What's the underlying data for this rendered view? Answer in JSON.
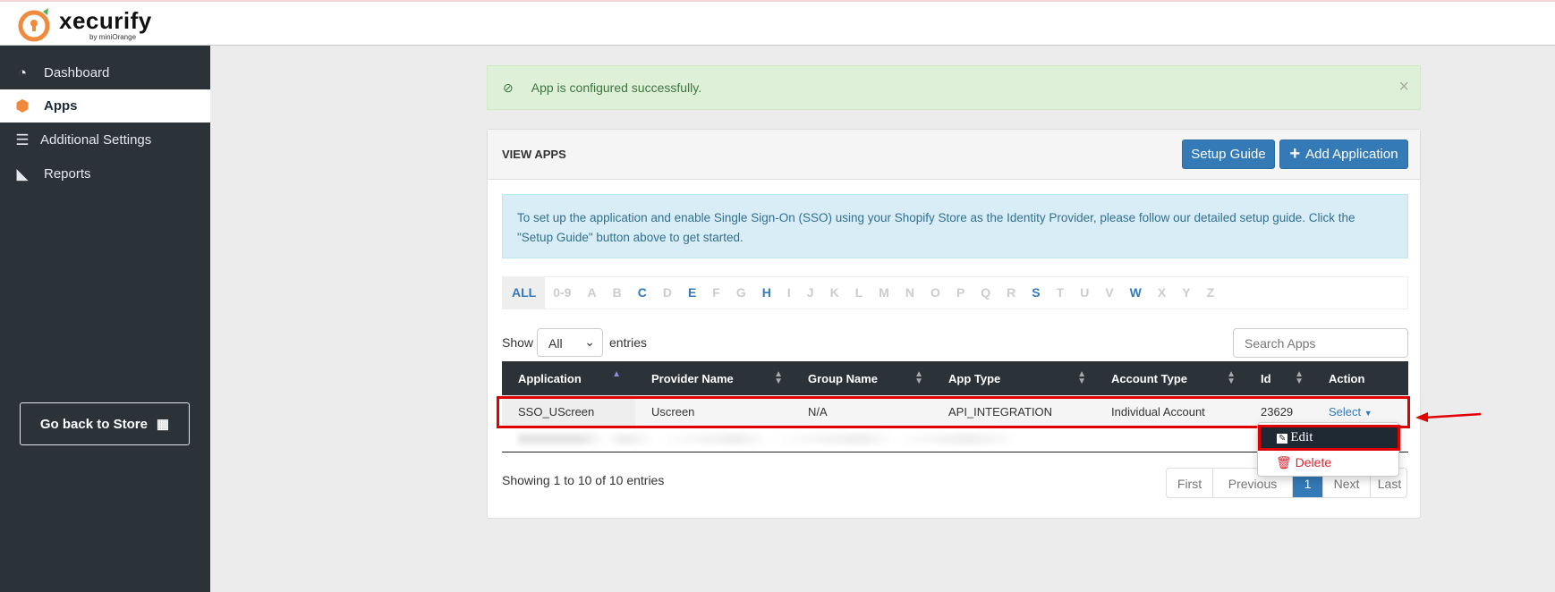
{
  "brand": {
    "name": "xecurify",
    "byline": "by miniOrange",
    "accent": "#f08a3c"
  },
  "sidebar": {
    "items": [
      {
        "label": "Dashboard",
        "icon": "dashboard-icon"
      },
      {
        "label": "Apps",
        "icon": "cube-icon",
        "active": true
      },
      {
        "label": "Additional Settings",
        "icon": "database-icon"
      },
      {
        "label": "Reports",
        "icon": "area-chart-icon"
      }
    ],
    "go_back": "Go back to Store"
  },
  "alert": {
    "text": "App is configured successfully.",
    "close": "×"
  },
  "panel": {
    "title": "VIEW APPS",
    "setup_guide": "Setup Guide",
    "add_application": "Add Application",
    "info": "To set up the application and enable Single Sign-On (SSO) using your Shopify Store as the Identity Provider, please follow our detailed setup guide. Click the \"Setup Guide\" button above to get started.",
    "letters": [
      "ALL",
      "0-9",
      "A",
      "B",
      "C",
      "D",
      "E",
      "F",
      "G",
      "H",
      "I",
      "J",
      "K",
      "L",
      "M",
      "N",
      "O",
      "P",
      "Q",
      "R",
      "S",
      "T",
      "U",
      "V",
      "W",
      "X",
      "Y",
      "Z"
    ],
    "active_letters": [
      "ALL",
      "C",
      "E",
      "H",
      "S",
      "W"
    ],
    "show_label": "Show",
    "entries_label": "entries",
    "show_value": "All",
    "search_placeholder": "Search Apps",
    "columns": [
      "Application",
      "Provider Name",
      "Group Name",
      "App Type",
      "Account Type",
      "Id",
      "Action"
    ],
    "rows": [
      {
        "application": "SSO_UScreen",
        "provider": "Uscreen",
        "group": "N/A",
        "app_type": "API_INTEGRATION",
        "account_type": "Individual Account",
        "id": "23629",
        "action": "Select"
      }
    ],
    "dropdown": {
      "edit": "Edit",
      "delete": "Delete"
    },
    "showing": "Showing 1 to 10 of 10 entries",
    "pagination": [
      "First",
      "Previous",
      "1",
      "Next",
      "Last"
    ],
    "current_page": "1"
  }
}
